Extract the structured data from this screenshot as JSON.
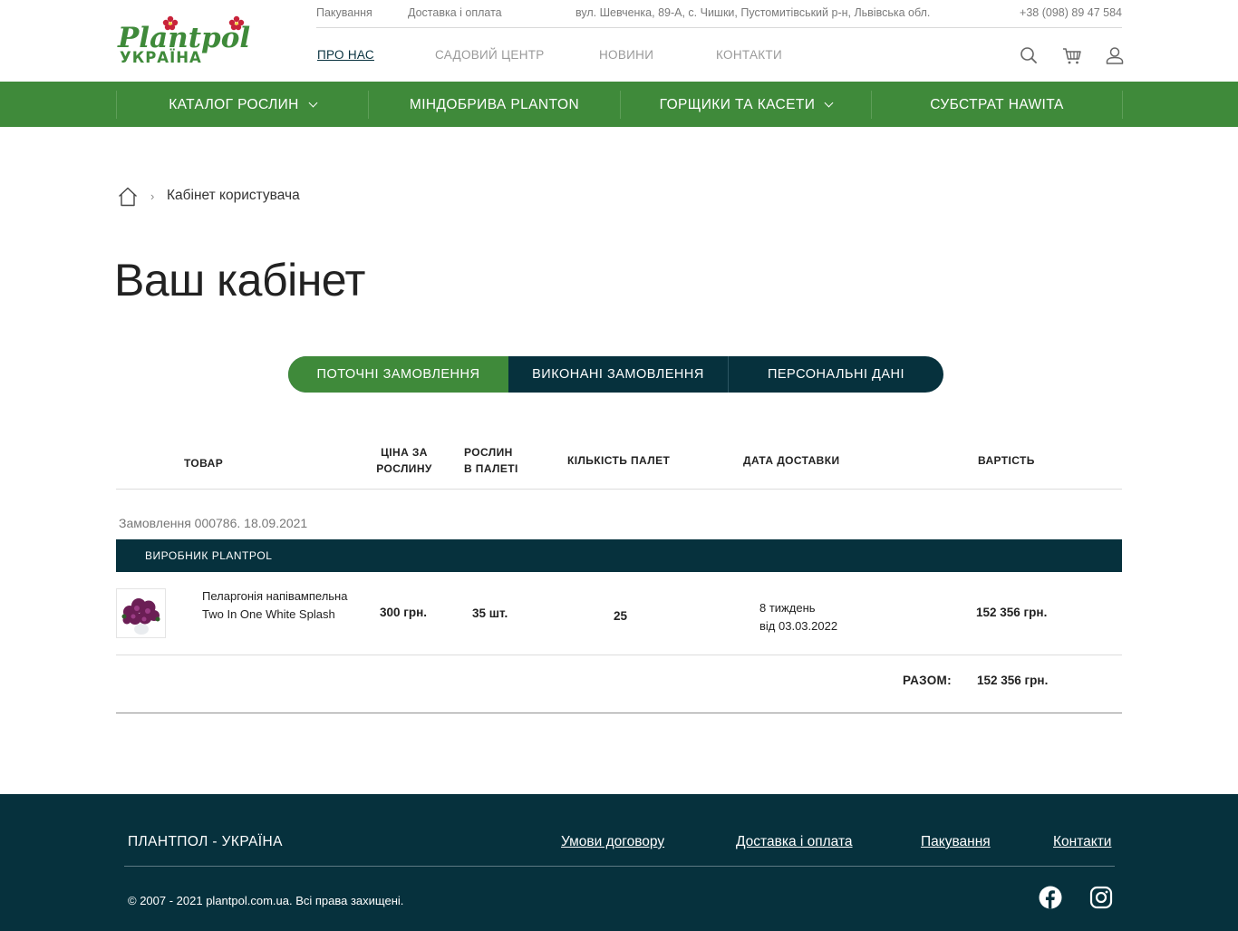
{
  "brand": {
    "logo_word": "Plantpol",
    "logo_sub": "УКРАЇНА"
  },
  "topbar": {
    "packaging": "Пакування",
    "delivery": "Доставка і оплата",
    "address": "вул. Шевченка, 89-А, с. Чишки, Пустомитівський р-н, Львівська обл.",
    "phone": "+38 (098) 89 47 584"
  },
  "nav": {
    "about": "ПРО НАС",
    "garden": "САДОВИЙ ЦЕНТР",
    "news": "НОВИНИ",
    "contacts": "КОНТАКТИ"
  },
  "category_bar": {
    "catalog": "КАТАЛОГ РОСЛИН",
    "fertilizers": "МІНДОБРИВА PLANTON",
    "pots": "ГОРЩИКИ ТА КАСЕТИ",
    "substrate": "СУБСТРАТ HAWITA"
  },
  "breadcrumb": {
    "current": "Кабінет користувача",
    "separator": "›"
  },
  "page_title": "Ваш кабінет",
  "tabs": {
    "current_orders": "ПОТОЧНІ ЗАМОВЛЕННЯ",
    "completed_orders": "ВИКОНАНІ ЗАМОВЛЕННЯ",
    "personal_data": "ПЕРСОНАЛЬНІ ДАНІ"
  },
  "table": {
    "headers": {
      "product": "ТОВАР",
      "price_l1": "ЦІНА ЗА",
      "price_l2": "РОСЛИНУ",
      "per_pallet_l1": "РОСЛИН",
      "per_pallet_l2": "В ПАЛЕТІ",
      "pallets": "КІЛЬКІСТЬ ПАЛЕТ",
      "delivery_date": "ДАТА ДОСТАВКИ",
      "cost": "ВАРТІСТЬ"
    },
    "order_label": "Замовлення 000786. 18.09.2021",
    "vendor": "ВИРОБНИК PLANTPOL",
    "row": {
      "name_l1": "Пеларгонія напівампельна",
      "name_l2": "Two In One White Splash",
      "price": "300 грн.",
      "per_pallet": "35 шт.",
      "pallets": "25",
      "date_l1": "8 тиждень",
      "date_l2": "від 03.03.2022",
      "cost": "152 356 грн."
    },
    "total_label": "РАЗОМ:",
    "total_value": "152 356 грн."
  },
  "footer": {
    "brand": "ПЛАНТПОЛ - УКРАЇНА",
    "terms": "Умови договору",
    "delivery": "Доставка і оплата",
    "packaging": "Пакування",
    "contacts": "Контакти",
    "copyright": "© 2007 - 2021 plantpol.com.ua. Всі права захищені."
  },
  "colors": {
    "green": "#3f8a3a",
    "dark_teal": "#06313d",
    "logo_red": "#c8233a"
  }
}
